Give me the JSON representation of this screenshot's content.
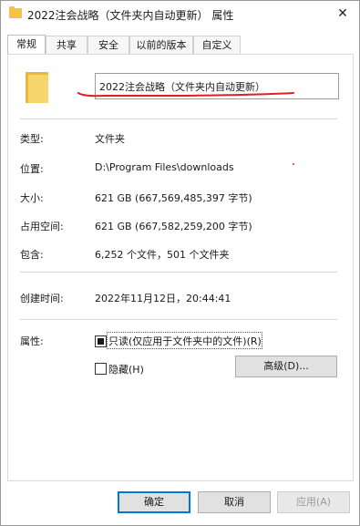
{
  "window": {
    "title": "2022注会战略（文件夹内自动更新） 属性",
    "close_glyph": "✕"
  },
  "tabs": [
    {
      "label": "常规",
      "active": true
    },
    {
      "label": "共享",
      "active": false
    },
    {
      "label": "安全",
      "active": false
    },
    {
      "label": "以前的版本",
      "active": false
    },
    {
      "label": "自定义",
      "active": false
    }
  ],
  "general": {
    "folder_name": "2022注会战略（文件夹内自动更新）",
    "fields": {
      "type_label": "类型:",
      "type_value": "文件夹",
      "location_label": "位置:",
      "location_value": "D:\\Program Files\\downloads",
      "size_label": "大小:",
      "size_value": "621 GB (667,569,485,397 字节)",
      "size_on_disk_label": "占用空间:",
      "size_on_disk_value": "621 GB (667,582,259,200 字节)",
      "contains_label": "包含:",
      "contains_value": "6,252 个文件，501 个文件夹",
      "created_label": "创建时间:",
      "created_value": "2022年11月12日，20:44:41"
    },
    "attributes": {
      "label": "属性:",
      "readonly_label": "只读(仅应用于文件夹中的文件)(R)",
      "readonly_state": "indeterminate",
      "hidden_label": "隐藏(H)",
      "hidden_checked": false,
      "advanced_label": "高级(D)..."
    }
  },
  "footer": {
    "ok_label": "确定",
    "cancel_label": "取消",
    "apply_label": "应用(A)"
  },
  "colors": {
    "annotation_red": "#e02020",
    "folder_yellow": "#f6d56e",
    "focus_blue": "#0078d7"
  }
}
